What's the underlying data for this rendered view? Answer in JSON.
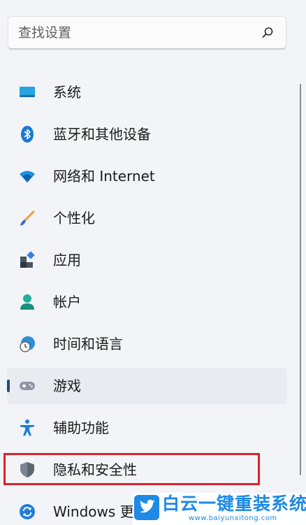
{
  "search": {
    "placeholder": "查找设置"
  },
  "nav": {
    "items": [
      {
        "label": "系统",
        "icon": "monitor-icon"
      },
      {
        "label": "蓝牙和其他设备",
        "icon": "bluetooth-icon"
      },
      {
        "label": "网络和 Internet",
        "icon": "wifi-icon"
      },
      {
        "label": "个性化",
        "icon": "paintbrush-icon"
      },
      {
        "label": "应用",
        "icon": "apps-icon"
      },
      {
        "label": "帐户",
        "icon": "account-icon"
      },
      {
        "label": "时间和语言",
        "icon": "globe-clock-icon"
      },
      {
        "label": "游戏",
        "icon": "gamepad-icon",
        "selected": true
      },
      {
        "label": "辅助功能",
        "icon": "accessibility-icon"
      },
      {
        "label": "隐私和安全性",
        "icon": "shield-icon"
      },
      {
        "label": "Windows 更",
        "icon": "update-icon"
      }
    ]
  },
  "watermark": {
    "brand": "白云一键重装系统",
    "url": "www.baiyunxitong.com"
  },
  "colors": {
    "accent": "#1d4e7a",
    "highlight": "#e0202a",
    "watermark": "#1e8ae6"
  }
}
